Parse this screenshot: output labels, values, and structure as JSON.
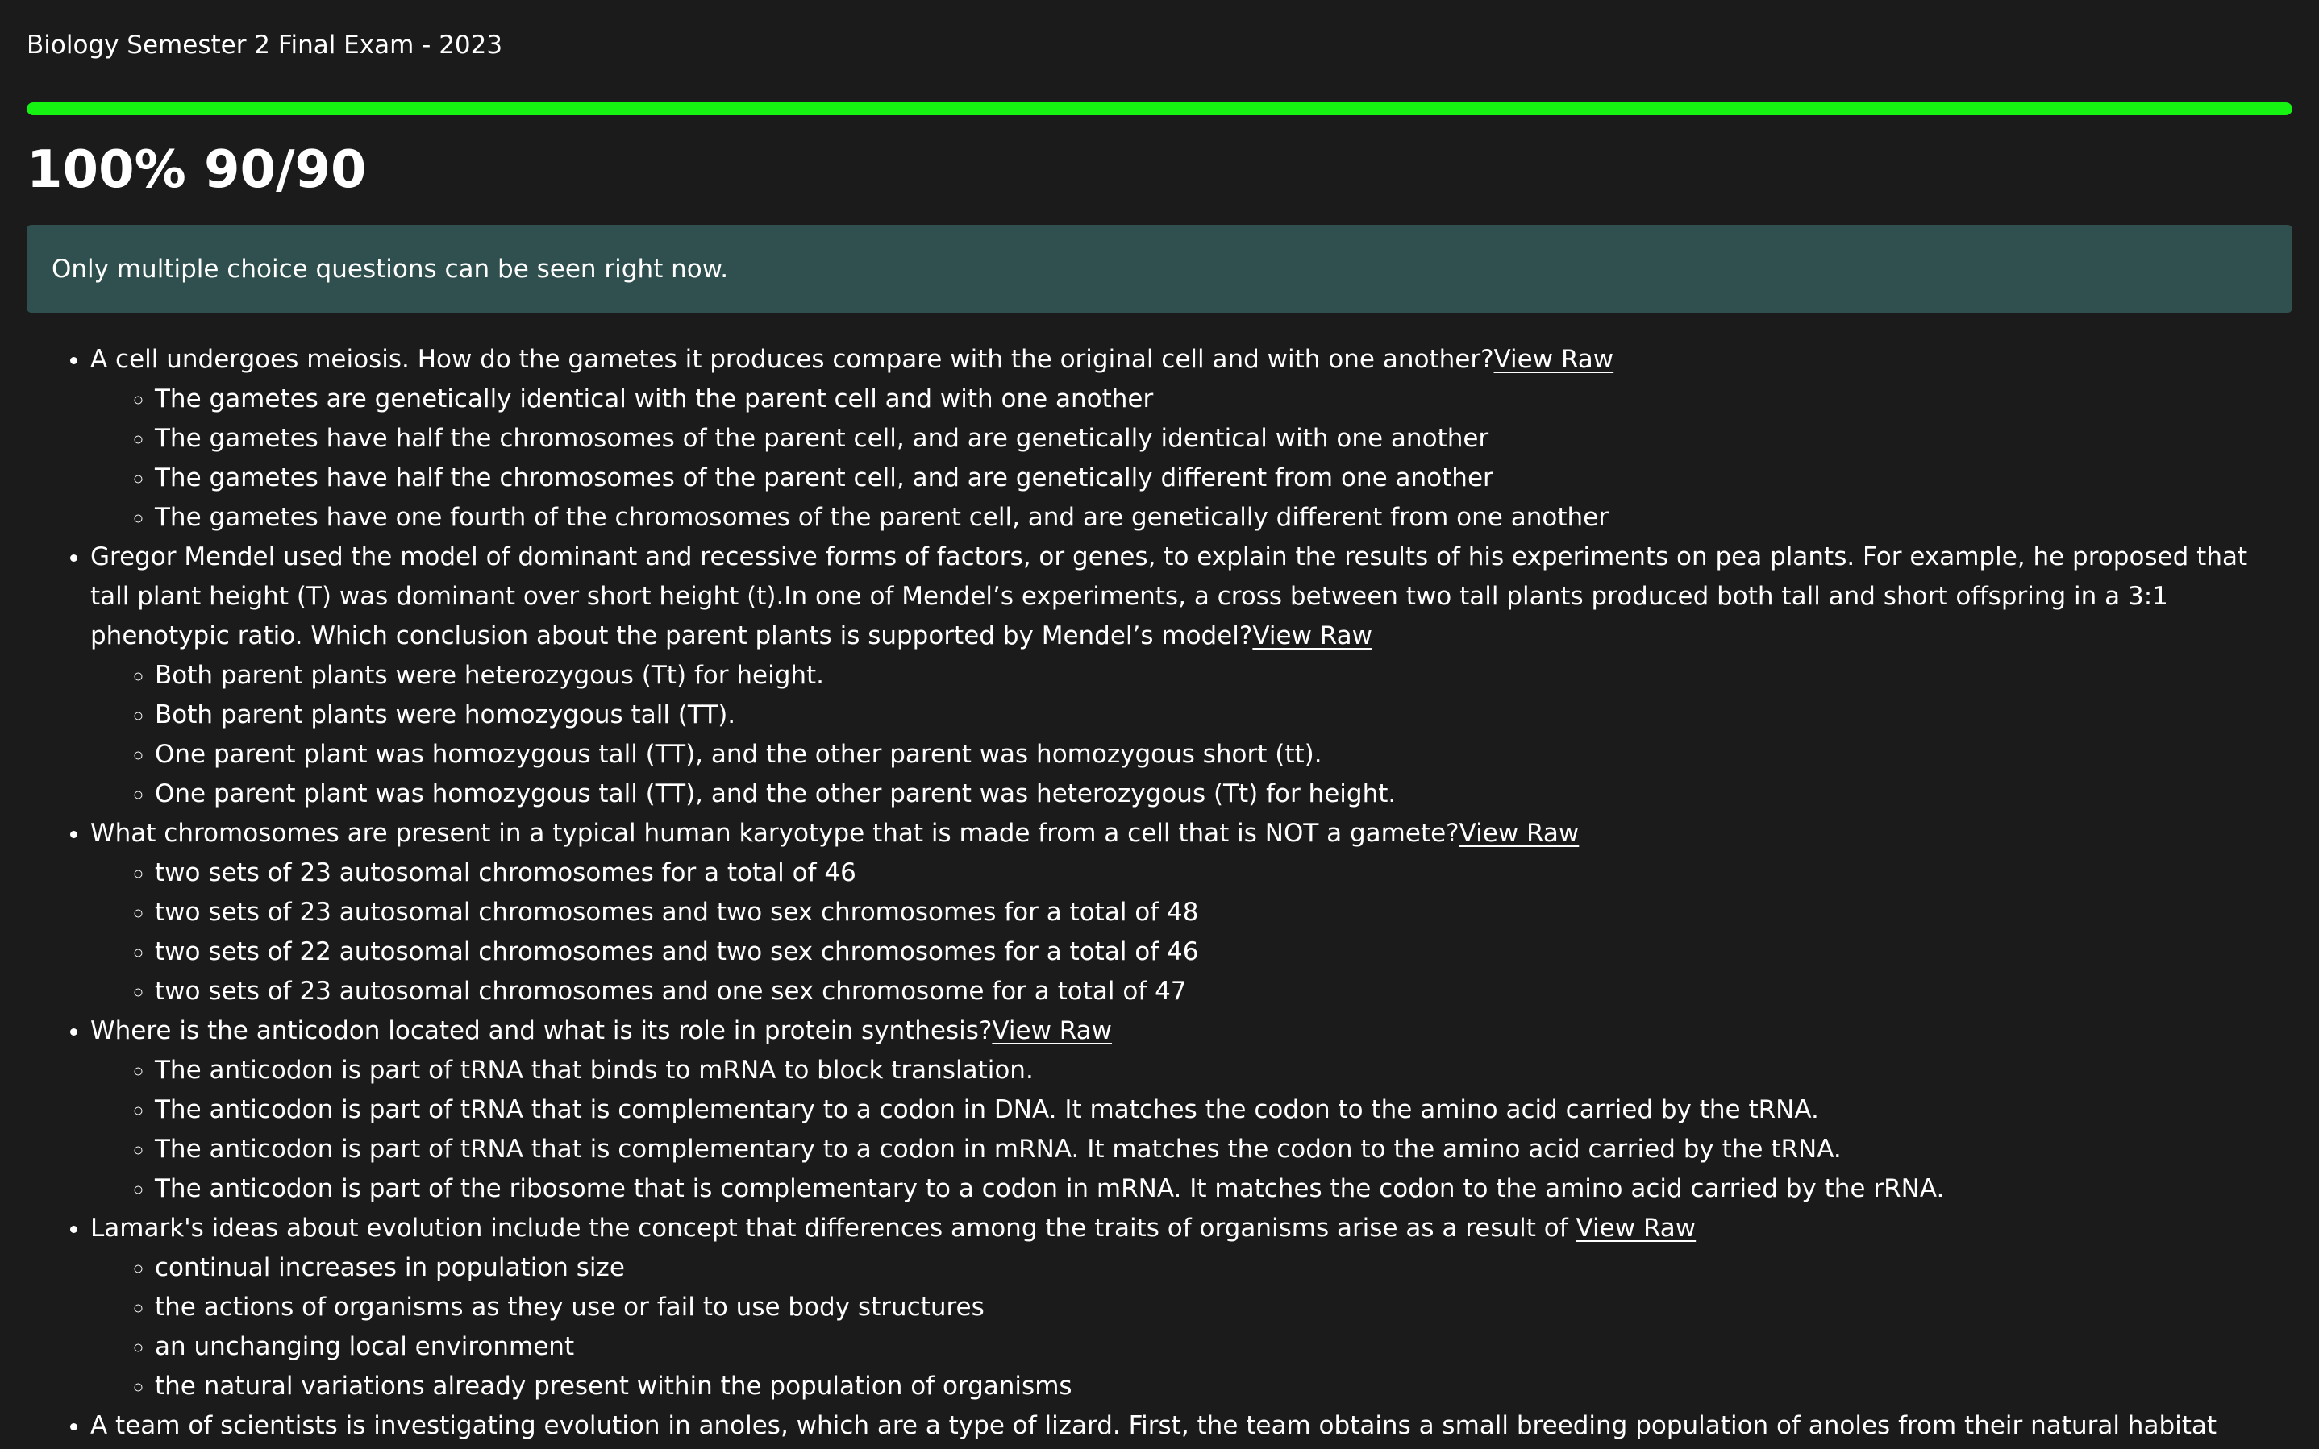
{
  "exam": {
    "title": "Biology Semester 2 Final Exam - 2023",
    "score_text": "100% 90/90",
    "progress_fraction": 1.0,
    "progress_color": "#16f212",
    "notice_text": "Only multiple choice questions can be seen right now.",
    "notice_bg": "#2f504e"
  },
  "view_raw_label": "View Raw",
  "questions": [
    {
      "text": "A cell undergoes meiosis. How do the gametes it produces compare with the original cell and with one another?",
      "options": [
        "The gametes are genetically identical with the parent cell and with one another",
        "The gametes have half the chromosomes of the parent cell, and are genetically identical with one another",
        "The gametes have half the chromosomes of the parent cell, and are genetically different from one another",
        "The gametes have one fourth of the chromosomes of the parent cell, and are genetically different from one another"
      ]
    },
    {
      "text": "Gregor Mendel used the model of dominant and recessive forms of factors, or genes, to explain the results of his experiments on pea plants. For example, he proposed that tall plant height (T) was dominant over short height (t).In one of Mendel’s experiments, a cross between two tall plants produced both tall and short offspring in a 3:1 phenotypic ratio. Which conclusion about the parent plants is supported by Mendel’s model?",
      "options": [
        "Both parent plants were heterozygous (Tt) for height.",
        "Both parent plants were homozygous tall (TT).",
        "One parent plant was homozygous tall (TT), and the other parent was homozygous short (tt).",
        "One parent plant was homozygous tall (TT), and the other parent was heterozygous (Tt) for height."
      ]
    },
    {
      "text": "What chromosomes are present in a typical human karyotype that is made from a cell that is NOT a gamete?",
      "options": [
        "two sets of 23 autosomal chromosomes for a total of 46",
        "two sets of 23 autosomal chromosomes and two sex chromosomes for a total of 48",
        "two sets of 22 autosomal chromosomes and two sex chromosomes for a total of 46",
        "two sets of 23 autosomal chromosomes and one sex chromosome for a total of 47"
      ]
    },
    {
      "text": "Where is the anticodon located and what is its role in protein synthesis?",
      "options": [
        "The anticodon is part of tRNA that binds to mRNA to block translation.",
        "The anticodon is part of tRNA that is complementary to a codon in DNA. It matches the codon to the amino acid carried by the tRNA.",
        "The anticodon is part of tRNA that is complementary to a codon in mRNA. It matches the codon to the amino acid carried by the tRNA.",
        "The anticodon is part of the ribosome that is complementary to a codon in mRNA. It matches the codon to the amino acid carried by the rRNA."
      ]
    },
    {
      "text": "Lamark's ideas about evolution include the concept that differences among the traits of organisms arise as a result of ",
      "options": [
        "continual increases in population size",
        "the actions of organisms as they use or fail to use body structures",
        "an unchanging local environment",
        "the natural variations already present within the population of organisms"
      ]
    },
    {
      "text": "A team of scientists is investigating evolution in anoles, which are a type of lizard. First, the team obtains a small breeding population of anoles from their natural habitat",
      "options": []
    }
  ]
}
